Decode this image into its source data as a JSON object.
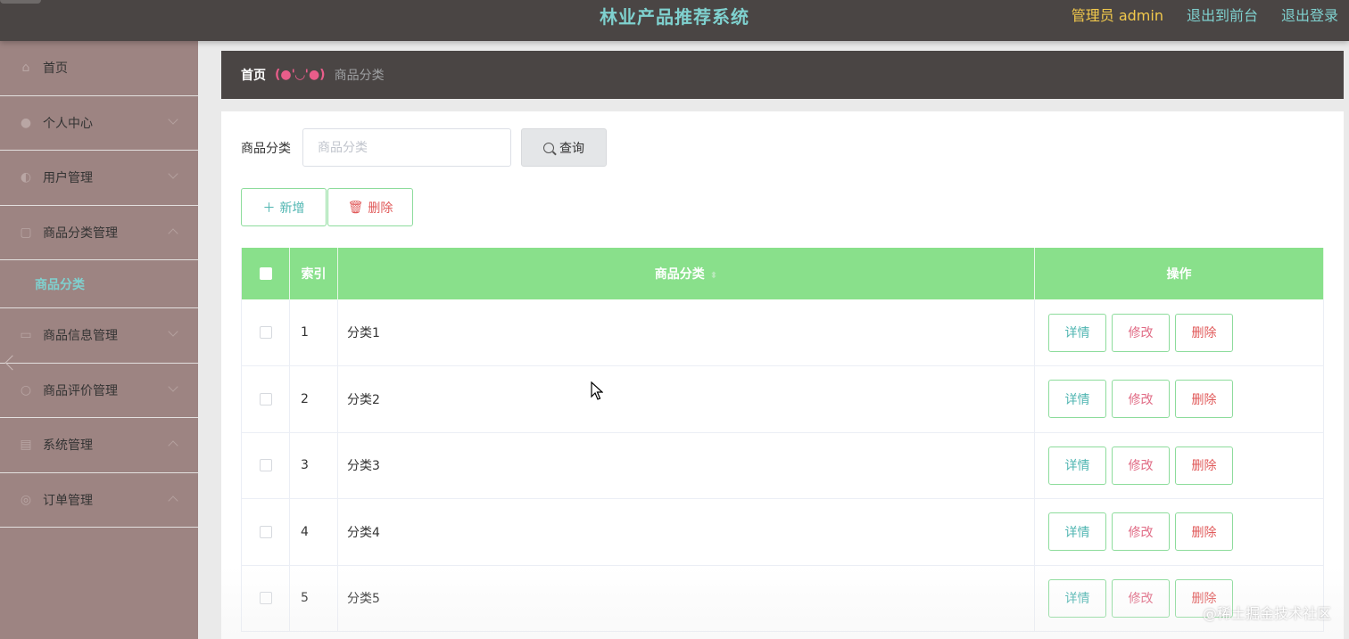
{
  "header": {
    "title": "林业产品推荐系统",
    "admin_label": "管理员 admin",
    "front_link": "退出到前台",
    "logout_link": "退出登录"
  },
  "sidebar": {
    "items": [
      {
        "label": "首页",
        "icon": "home-icon"
      },
      {
        "label": "个人中心",
        "icon": "person-icon"
      },
      {
        "label": "用户管理",
        "icon": "user-manage-icon"
      },
      {
        "label": "商品分类管理",
        "icon": "category-icon",
        "sub": "商品分类"
      },
      {
        "label": "商品信息管理",
        "icon": "goods-icon"
      },
      {
        "label": "商品评价管理",
        "icon": "review-icon"
      },
      {
        "label": "系统管理",
        "icon": "system-icon"
      },
      {
        "label": "订单管理",
        "icon": "order-icon"
      }
    ]
  },
  "breadcrumb": {
    "home": "首页",
    "face": "(●'◡'●)",
    "current": "商品分类"
  },
  "search": {
    "label": "商品分类",
    "placeholder": "商品分类",
    "button": "查询"
  },
  "actions": {
    "add": "新增",
    "delete": "删除"
  },
  "table": {
    "headers": {
      "index": "索引",
      "name": "商品分类",
      "ops": "操作"
    },
    "rows": [
      {
        "index": "1",
        "name": "分类1"
      },
      {
        "index": "2",
        "name": "分类2"
      },
      {
        "index": "3",
        "name": "分类3"
      },
      {
        "index": "4",
        "name": "分类4"
      },
      {
        "index": "5",
        "name": "分类5"
      }
    ],
    "row_actions": {
      "detail": "详情",
      "edit": "修改",
      "remove": "删除"
    }
  },
  "watermark": "@稀土掘金技术社区",
  "colors": {
    "header_bg": "#4a4544",
    "sidebar_bg": "#9d8482",
    "accent_teal": "#7fd1cf",
    "table_header": "#89e08b",
    "danger": "#e05a5a"
  }
}
